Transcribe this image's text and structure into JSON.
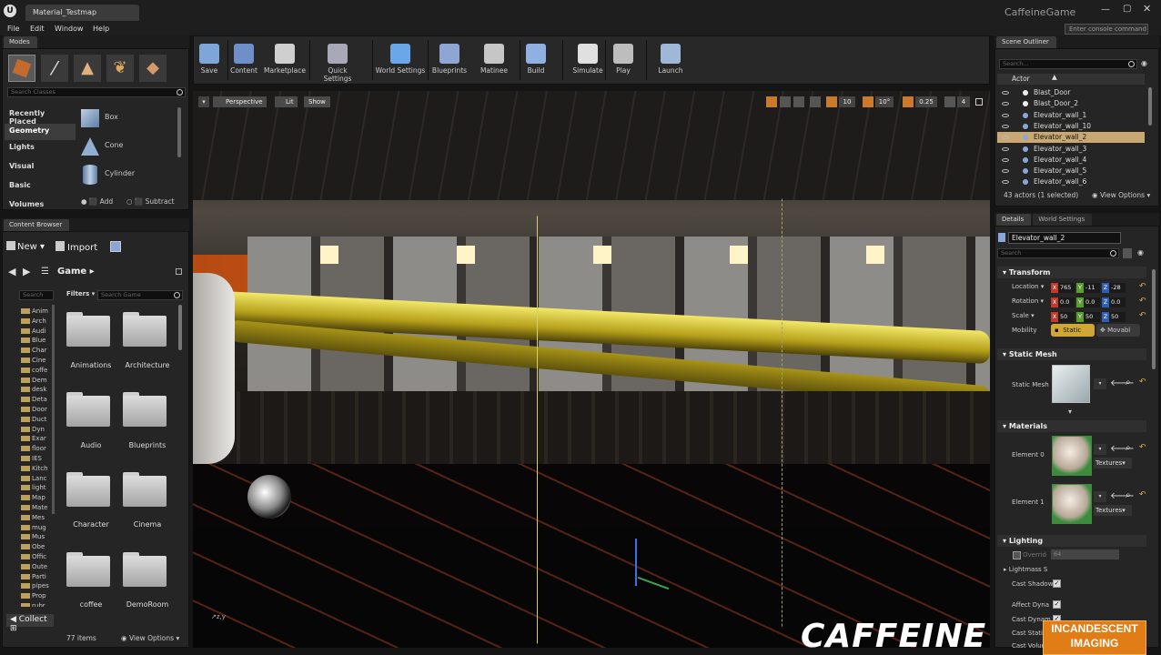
{
  "titlebar": {
    "logo": "U",
    "tab": "Material_Testmap",
    "game": "CaffeineGame",
    "console_placeholder": "Enter console command"
  },
  "menu": [
    "File",
    "Edit",
    "Window",
    "Help"
  ],
  "modes": {
    "tab": "Modes",
    "search_placeholder": "Search Classes",
    "categories": [
      "Recently Placed",
      "Geometry",
      "Lights",
      "Visual",
      "Basic",
      "Volumes"
    ],
    "items": [
      "Box",
      "Cone",
      "Cylinder"
    ],
    "add": "Add",
    "subtract": "Subtract"
  },
  "toolbar": [
    "Save",
    "Content",
    "Marketplace",
    "Quick Settings",
    "World Settings",
    "Blueprints",
    "Matinee",
    "Build",
    "Simulate",
    "Play",
    "Launch"
  ],
  "viewport": {
    "perspective": "Perspective",
    "lit": "Lit",
    "show": "Show",
    "snap_grid": "10",
    "snap_angle": "10°",
    "snap_scale": "0.25",
    "camera_speed": "4"
  },
  "content_browser": {
    "tab": "Content Browser",
    "new": "New",
    "import": "Import",
    "path": "Game",
    "search_tree": "Search",
    "filters": "Filters",
    "search_game": "Search Game",
    "tree": [
      "Anim",
      "Arch",
      "Audi",
      "Blue",
      "Char",
      "Cine",
      "coffe",
      "Dem",
      "desk",
      "Deta",
      "Door",
      "Duct",
      "Dyn",
      "Exar",
      "floor",
      "IES",
      "Kitch",
      "Lanc",
      "light",
      "Map",
      "Mate",
      "Mes",
      "mug",
      "Mus",
      "Obe",
      "Offic",
      "Oute",
      "Parti",
      "pipes",
      "Prop",
      "rubr"
    ],
    "folders": [
      "Animations",
      "Architecture",
      "Audio",
      "Blueprints",
      "Character",
      "Cinema",
      "coffee",
      "DemoRoom"
    ],
    "count": "77 items",
    "view_options": "View Options",
    "collections": "Collect"
  },
  "outliner": {
    "tab": "Scene Outliner",
    "search_placeholder": "Search...",
    "column": "Actor",
    "items": [
      "Blast_Door",
      "Blast_Door_2",
      "Elevator_wall_1",
      "Elevator_wall_10",
      "Elevator_wall_2",
      "Elevator_wall_3",
      "Elevator_wall_4",
      "Elevator_wall_5",
      "Elevator_wall_6"
    ],
    "selected_index": 4,
    "summary": "43 actors (1 selected)",
    "view_options": "View Options"
  },
  "details": {
    "tab": "Details",
    "tab2": "World Settings",
    "name": "Elevator_wall_2",
    "search_placeholder": "Search",
    "transform": {
      "title": "Transform",
      "location": "Location",
      "rotation": "Rotation",
      "scale": "Scale",
      "mobility": "Mobility",
      "loc": [
        "765",
        "-11",
        "-28"
      ],
      "rot": [
        "0.0",
        "0.0",
        "0.0"
      ],
      "scl": [
        "50",
        "50",
        "50"
      ],
      "static": "Static",
      "movable": "Movabl"
    },
    "static_mesh": {
      "title": "Static Mesh",
      "label": "Static Mesh"
    },
    "materials": {
      "title": "Materials",
      "element0": "Element 0",
      "element1": "Element 1",
      "textures": "Textures"
    },
    "lighting": {
      "title": "Lighting",
      "override": "Overrid",
      "override_val": "64",
      "lightmass": "Lightmass S",
      "cast_shadow": "Cast Shadow",
      "affect_dynamic": "Affect Dyna",
      "cast_dynamic": "Cast Dynam",
      "cast_static": "Cast Static",
      "cast_volumetric": "Cast Volum"
    }
  },
  "watermark": {
    "caffeine": "CAFFEINE",
    "incandescent": "INCANDESCENT",
    "imaging": "IMAGING"
  },
  "colors": {
    "accent": "#c9a874",
    "static_mobility": "#d1a733",
    "x": "#c0392b",
    "y": "#5a9e2f",
    "z": "#2f5fb0"
  }
}
